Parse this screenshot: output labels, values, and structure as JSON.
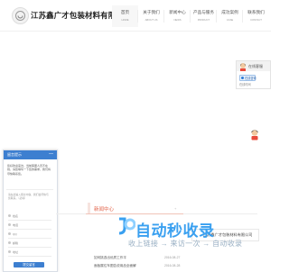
{
  "header": {
    "company_name": "江苏鑫广才包装材料有限公司",
    "nav": [
      {
        "label": "首页",
        "en": "HOME",
        "active": true
      },
      {
        "label": "关于我们",
        "en": "ABOUT US"
      },
      {
        "label": "新闻中心",
        "en": "NEWS"
      },
      {
        "label": "产品与服务",
        "en": "PRODUCT"
      },
      {
        "label": "成功案例",
        "en": "CASE"
      },
      {
        "label": "联系我们",
        "en": "CONTACT"
      }
    ]
  },
  "chat_widget": {
    "title": "留言提示",
    "minimize": "—",
    "message": "您好欢迎来访，当前客服人员不在线，请您填写一下您的需求，我们将尽快联系您。",
    "prompt": "请在此输入留言内容，我们会尽快与您联系。（必填）",
    "fields": [
      "姓名",
      "电话",
      "QQ",
      "邮箱",
      "地址"
    ],
    "submit": "提交留言"
  },
  "float_service": {
    "title": "在线客服",
    "qq_label": "在线咨询",
    "status": "在线时间"
  },
  "news": {
    "tab": "新闻中心",
    "more": "+",
    "items": [
      {
        "title": "如何挑选出优质工作平",
        "date": "2016-08-27"
      },
      {
        "title": "面板展位车图告说用品全面解",
        "date": "2016-08-28"
      }
    ]
  },
  "contact": {
    "company": "江苏鑫广才包装材料有限公司"
  },
  "watermark": {
    "main": "自动秒收录",
    "sub": "收上链接 → 来访一次 → 自动收录"
  },
  "colors": {
    "accent_blue": "#3d7fd0",
    "news_red": "#e25f45",
    "watermark_blue": "#3aa0f0"
  }
}
